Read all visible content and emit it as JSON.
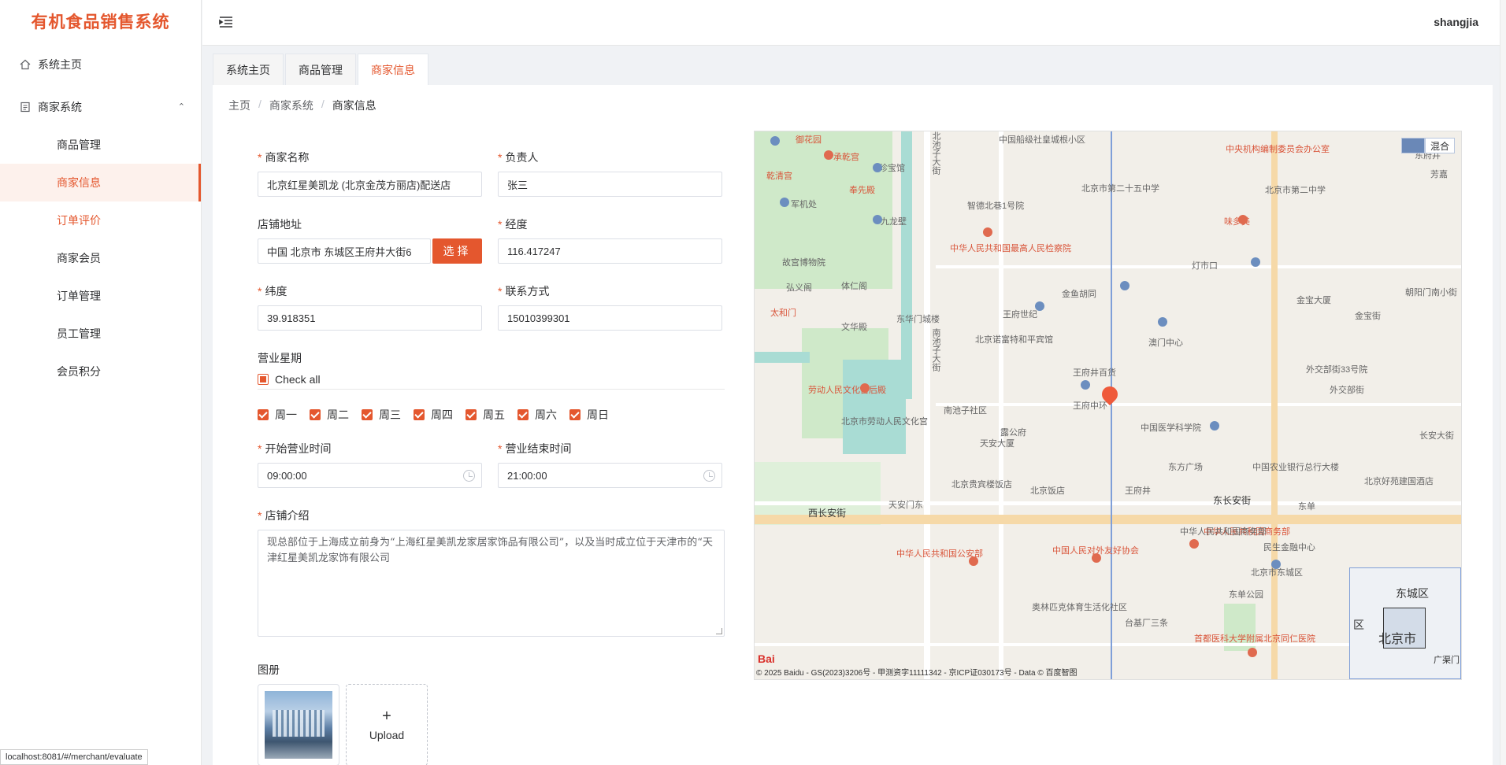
{
  "app": {
    "title": "有机食品销售系统",
    "user": "shangjia"
  },
  "sidebar": {
    "items": [
      {
        "label": "系统主页",
        "icon": "home-icon"
      },
      {
        "label": "商家系统",
        "icon": "document-icon"
      },
      {
        "label": "商品管理"
      },
      {
        "label": "商家信息"
      },
      {
        "label": "订单评价"
      },
      {
        "label": "商家会员"
      },
      {
        "label": "订单管理"
      },
      {
        "label": "员工管理"
      },
      {
        "label": "会员积分"
      }
    ]
  },
  "tabs": [
    "系统主页",
    "商品管理",
    "商家信息"
  ],
  "breadcrumb": [
    "主页",
    "商家系统",
    "商家信息"
  ],
  "form": {
    "shop_name": {
      "label": "商家名称",
      "value": "北京红星美凯龙 (北京金茂方丽店)配送店"
    },
    "owner": {
      "label": "负责人",
      "value": "张三"
    },
    "address": {
      "label": "店铺地址",
      "value": "中国 北京市 东城区王府井大街6",
      "button": "选择"
    },
    "longitude": {
      "label": "经度",
      "value": "116.417247"
    },
    "latitude": {
      "label": "纬度",
      "value": "39.918351"
    },
    "contact": {
      "label": "联系方式",
      "value": "15010399301"
    },
    "weekdays": {
      "label": "营业星期",
      "check_all": "Check all",
      "days": [
        "周一",
        "周二",
        "周三",
        "周四",
        "周五",
        "周六",
        "周日"
      ]
    },
    "open_time": {
      "label": "开始营业时间",
      "value": "09:00:00"
    },
    "close_time": {
      "label": "营业结束时间",
      "value": "21:00:00"
    },
    "intro": {
      "label": "店铺介绍",
      "value": "现总部位于上海成立前身为“上海红星美凯龙家居家饰品有限公司”，以及当时成立位于天津市的“天津红星美凯龙家饰有限公司"
    },
    "album": {
      "label": "图册",
      "upload": "Upload"
    }
  },
  "map": {
    "type_label": "混合",
    "copyright": "© 2025 Baidu - GS(2023)3206号 - 甲测资字11111342 - 京ICP证030173号 - Data © 百度智图",
    "logo": "Bai",
    "overview_labels": [
      "东城区",
      "北京市",
      "区",
      "广渠门"
    ],
    "labels": [
      {
        "text": "御花园",
        "red": true
      },
      {
        "text": "承乾宫",
        "red": true
      },
      {
        "text": "乾清宫",
        "red": true
      },
      {
        "text": "珍宝馆"
      },
      {
        "text": "奉先殿",
        "red": true
      },
      {
        "text": "军机处"
      },
      {
        "text": "九龙壁"
      },
      {
        "text": "故宫博物院"
      },
      {
        "text": "弘义阁"
      },
      {
        "text": "体仁阁"
      },
      {
        "text": "太和门",
        "red": true
      },
      {
        "text": "文华殿"
      },
      {
        "text": "东华门城楼"
      },
      {
        "text": "劳动人民文化宫后殿",
        "red": true
      },
      {
        "text": "北京市劳动人民文化宫"
      },
      {
        "text": "南池子社区"
      },
      {
        "text": "南池子大街"
      },
      {
        "text": "北池子大街"
      },
      {
        "text": "中国船级社皇城根小区"
      },
      {
        "text": "智德北巷1号院"
      },
      {
        "text": "中华人民共和国最高人民检察院",
        "red": true
      },
      {
        "text": "北京市第二十五中学"
      },
      {
        "text": "中央机构编制委员会办公室",
        "red": true
      },
      {
        "text": "王府井"
      },
      {
        "text": "金鱼胡同"
      },
      {
        "text": "王府世纪"
      },
      {
        "text": "北京诺富特和平宾馆"
      },
      {
        "text": "王府井百货"
      },
      {
        "text": "王府中环"
      },
      {
        "text": "澳门中心"
      },
      {
        "text": "灯市口"
      },
      {
        "text": "北京市第二中学"
      },
      {
        "text": "味多美",
        "red": true
      },
      {
        "text": "金宝大厦"
      },
      {
        "text": "金宝街"
      },
      {
        "text": "外交部街33号院"
      },
      {
        "text": "外交部街"
      },
      {
        "text": "东方广场"
      },
      {
        "text": "中国医学科学院"
      },
      {
        "text": "东长安街",
        "bold": true
      },
      {
        "text": "西长安街",
        "bold": true
      },
      {
        "text": "天安门东"
      },
      {
        "text": "北京饭店"
      },
      {
        "text": "中华人民共和国商务部",
        "red": true
      },
      {
        "text": "中华人民共和国公安部",
        "red": true
      },
      {
        "text": "中国人民对外友好协会",
        "red": true
      },
      {
        "text": "民生金融中心"
      },
      {
        "text": "东单公园"
      },
      {
        "text": "东单"
      },
      {
        "text": "北京市东城区"
      },
      {
        "text": "奥林匹克体育生活化社区"
      },
      {
        "text": "台基厂三条"
      },
      {
        "text": "首都医科大学附属北京同仁医院",
        "red": true
      },
      {
        "text": "芳嘉"
      },
      {
        "text": "朝阳门南小街"
      },
      {
        "text": "长安大街"
      },
      {
        "text": "露公府"
      },
      {
        "text": "天安大厦"
      },
      {
        "text": "北京贵宾楼饭店"
      },
      {
        "text": "中国农业银行总行大楼"
      },
      {
        "text": "北京好苑建国酒店"
      },
      {
        "text": "中华人民共和国商务部"
      },
      {
        "text": "东府井"
      }
    ]
  },
  "status_bar": "localhost:8081/#/merchant/evaluate"
}
